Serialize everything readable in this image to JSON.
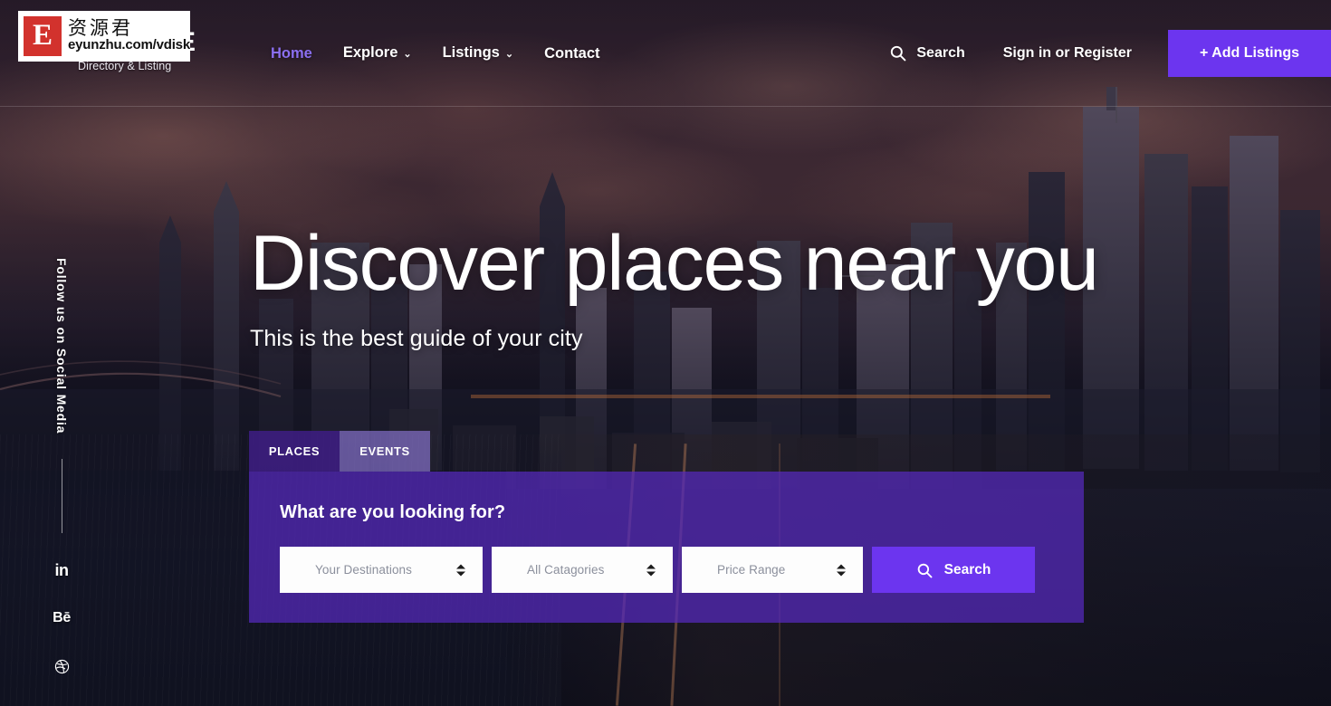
{
  "brand": {
    "logo_letter": "E",
    "watermark_badge_letter": "E",
    "watermark_cn": "资源君",
    "watermark_url": "eyunzhu.com/vdisk",
    "tagline": "Directory & Listing"
  },
  "nav": {
    "items": [
      {
        "label": "Home",
        "active": true,
        "caret": ""
      },
      {
        "label": "Explore",
        "active": false,
        "caret": "⌄"
      },
      {
        "label": "Listings",
        "active": false,
        "caret": "⌄"
      },
      {
        "label": "Contact",
        "active": false,
        "caret": ""
      }
    ]
  },
  "header_actions": {
    "search_label": "Search",
    "search_icon": "search-icon",
    "signin_label": "Sign in or Register",
    "add_listings_label": "+ Add Listings"
  },
  "social": {
    "label": "Follow us on Social Media",
    "items": [
      {
        "name": "linkedin-icon",
        "glyph": "in"
      },
      {
        "name": "behance-icon",
        "glyph": "Bē"
      },
      {
        "name": "dribbble-icon",
        "glyph": ""
      }
    ]
  },
  "hero": {
    "title": "Discover places near you",
    "subtitle": "This is the best guide of your city"
  },
  "search_panel": {
    "tabs": [
      {
        "label": "PLACES",
        "active": true
      },
      {
        "label": "EVENTS",
        "active": false
      }
    ],
    "heading": "What are you looking for?",
    "fields": [
      {
        "name": "destination-select",
        "value": "Your Destinations"
      },
      {
        "name": "category-select",
        "value": "All Catagories"
      },
      {
        "name": "price-select",
        "value": "Price Range"
      }
    ],
    "search_button_label": "Search",
    "search_button_icon": "search-icon"
  },
  "colors": {
    "accent_purple": "#6c35ef",
    "panel_purple": "rgba(86,42,190,0.72)",
    "tab_active": "rgba(61,30,130,0.88)",
    "tab_inactive": "rgba(146,122,221,0.62)",
    "nav_active": "#8b6ff0",
    "watermark_red": "#d2322d"
  }
}
